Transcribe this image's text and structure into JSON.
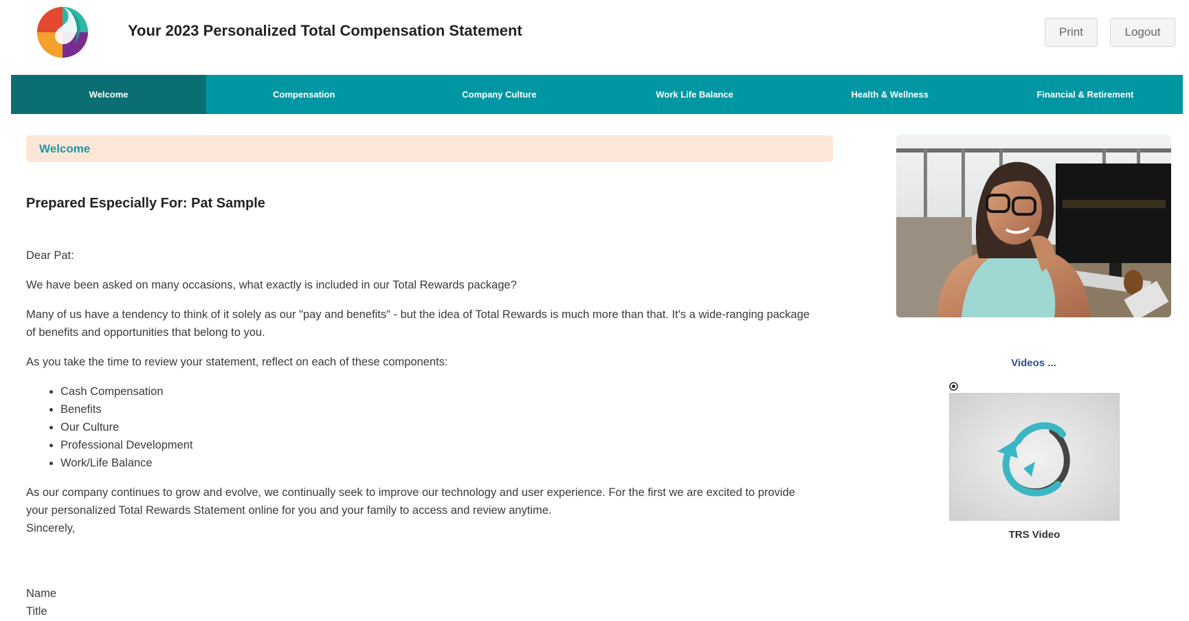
{
  "header": {
    "title": "Your 2023 Personalized Total Compensation Statement",
    "print_label": "Print",
    "logout_label": "Logout"
  },
  "nav": {
    "tabs": [
      {
        "label": "Welcome",
        "active": true
      },
      {
        "label": "Compensation",
        "active": false
      },
      {
        "label": "Company Culture",
        "active": false
      },
      {
        "label": "Work Life Balance",
        "active": false
      },
      {
        "label": "Health & Wellness",
        "active": false
      },
      {
        "label": "Financial & Retirement",
        "active": false
      }
    ]
  },
  "main": {
    "section_title": "Welcome",
    "prepared_for": "Prepared Especially For: Pat Sample",
    "greeting": "Dear Pat:",
    "para1": "We have been asked on many occasions, what exactly is included in our Total Rewards package?",
    "para2": "Many of us have a tendency to think of it solely as our \"pay and benefits\" - but the idea of Total Rewards is much more than that. It's a wide-ranging package of benefits and opportunities that belong to you.",
    "para3": "As you take the time to review your statement, reflect on each of these components:",
    "components": [
      "Cash Compensation",
      "Benefits",
      "Our Culture",
      "Professional Development",
      "Work/Life Balance"
    ],
    "para4": "As our company continues to grow and evolve, we continually seek to improve our technology and user experience. For the first we are excited to provide your personalized Total Rewards Statement online for you and your family to access and review anytime.",
    "closing": "Sincerely,",
    "signature_name": "Name",
    "signature_title": "Title"
  },
  "sidebar": {
    "videos_link": "Videos ...",
    "video_caption": "TRS Video"
  },
  "colors": {
    "nav_bg": "#0097a2",
    "nav_active": "#0b6e72",
    "banner_bg": "#fce6d8",
    "accent_text": "#1a9aa3",
    "link": "#2a4f9a"
  },
  "icons": {
    "logo": "logo-icon",
    "play": "play-icon"
  }
}
